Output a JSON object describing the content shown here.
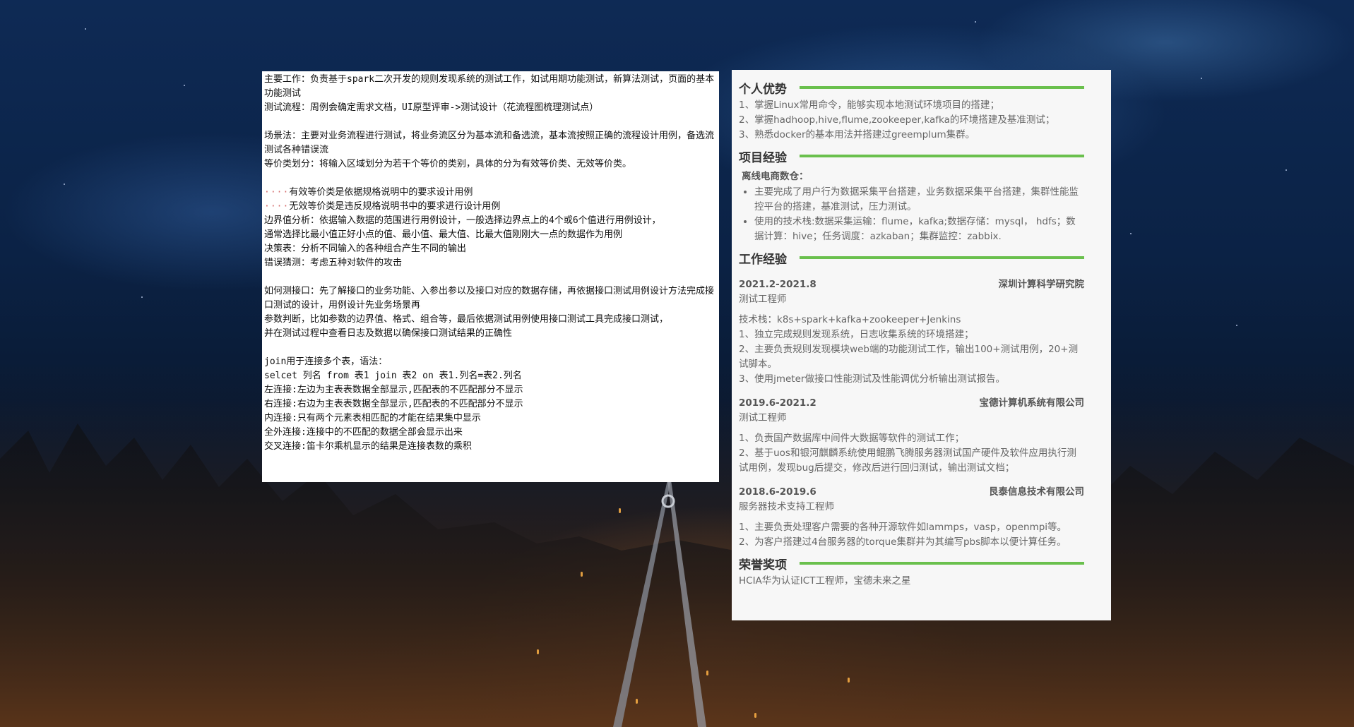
{
  "notes": {
    "lines": [
      "主要工作：负责基于spark二次开发的规则发现系统的测试工作，如试用期功能测试，新算法测试，页面的基本功能测试",
      "测试流程：周例会确定需求文档，UI原型评审->测试设计（花流程图梳理测试点）",
      "",
      "场景法：主要对业务流程进行测试，将业务流区分为基本流和备选流，基本流按照正确的流程设计用例，备选流测试各种错误流",
      "等价类划分：将输入区域划分为若干个等价的类别，具体的分为有效等价类、无效等价类。",
      "",
      "有效等价类是依据规格说明中的要求设计用例",
      "无效等价类是违反规格说明书中的要求进行设计用例",
      "边界值分析：依据输入数据的范围进行用例设计，一般选择边界点上的4个或6个值进行用例设计，",
      "通常选择比最小值正好小点的值、最小值、最大值、比最大值刚刚大一点的数据作为用例",
      "决策表：分析不同输入的各种组合产生不同的输出",
      "错误猜测：考虑五种对软件的攻击",
      "",
      "如何测接口：先了解接口的业务功能、入参出参以及接口对应的数据存储，再依据接口测试用例设计方法完成接口测试的设计，用例设计先业务场景再",
      "参数判断，比如参数的边界值、格式、组合等，最后依据测试用例使用接口测试工具完成接口测试，",
      "并在测试过程中查看日志及数据以确保接口测试结果的正确性",
      "",
      "join用于连接多个表，语法：",
      "selcet 列名 from 表1 join 表2 on 表1.列名=表2.列名",
      "左连接:左边为主表表数据全部显示,匹配表的不匹配部分不显示",
      "右连接:右边为主表表数据全部显示,匹配表的不匹配部分不显示",
      "内连接:只有两个元素表相匹配的才能在结果集中显示",
      "全外连接:连接中的不匹配的数据全部会显示出来",
      "交叉连接:笛卡尔乘机显示的结果是连接表数的乘积"
    ],
    "indent_dots": "····"
  },
  "resume": {
    "advantages": {
      "title": "个人优势",
      "items": [
        "1、掌握Linux常用命令，能够实现本地测试环境项目的搭建；",
        "2、掌握hadhoop,hive,flume,zookeeper,kafka的环境搭建及基准测试；",
        "3、熟悉docker的基本用法并搭建过greemplum集群。"
      ]
    },
    "projects": {
      "title": "项目经验",
      "name": "离线电商数仓：",
      "bullets": [
        "主要完成了用户行为数据采集平台搭建，业务数据采集平台搭建，集群性能监控平台的搭建，基准测试，压力测试。",
        "使用的技术栈:数据采集运输：flume，kafka;数据存储：mysql， hdfs；数据计算：hive；任务调度：azkaban；集群监控：zabbix."
      ]
    },
    "work": {
      "title": "工作经验",
      "jobs": [
        {
          "period": "2021.2-2021.8",
          "company": "深圳计算科学研究院",
          "role": "测试工程师",
          "lines": [
            "技术栈：k8s+spark+kafka+zookeeper+Jenkins",
            "1、独立完成规则发现系统，日志收集系统的环境搭建；",
            "2、主要负责规则发现模块web端的功能测试工作，输出100+测试用例，20+测试脚本。",
            "3、使用jmeter做接口性能测试及性能调优分析输出测试报告。"
          ]
        },
        {
          "period": "2019.6-2021.2",
          "company": "宝德计算机系统有限公司",
          "role": "测试工程师",
          "lines": [
            "1、负责国产数据库中间件大数据等软件的测试工作；",
            "2、基于uos和银河麒麟系统使用鲲鹏飞腾服务器测试国产硬件及软件应用执行测试用例，发现bug后提交，修改后进行回归测试，输出测试文档；"
          ]
        },
        {
          "period": "2018.6-2019.6",
          "company": "艮泰信息技术有限公司",
          "role": "服务器技术支持工程师",
          "lines": [
            "1、主要负责处理客户需要的各种开源软件如lammps，vasp，openmpi等。",
            "2、为客户搭建过4台服务器的torque集群并为其编写pbs脚本以便计算任务。"
          ]
        }
      ]
    },
    "honors": {
      "title": "荣誉奖项",
      "text": "HCIA华为认证ICT工程师，宝德未来之星"
    }
  },
  "colors": {
    "accent_green": "#6ac04d",
    "section_title": "#333333",
    "body_text": "#666666",
    "notes_bg": "#ffffff",
    "resume_bg": "#f7f7f7"
  }
}
